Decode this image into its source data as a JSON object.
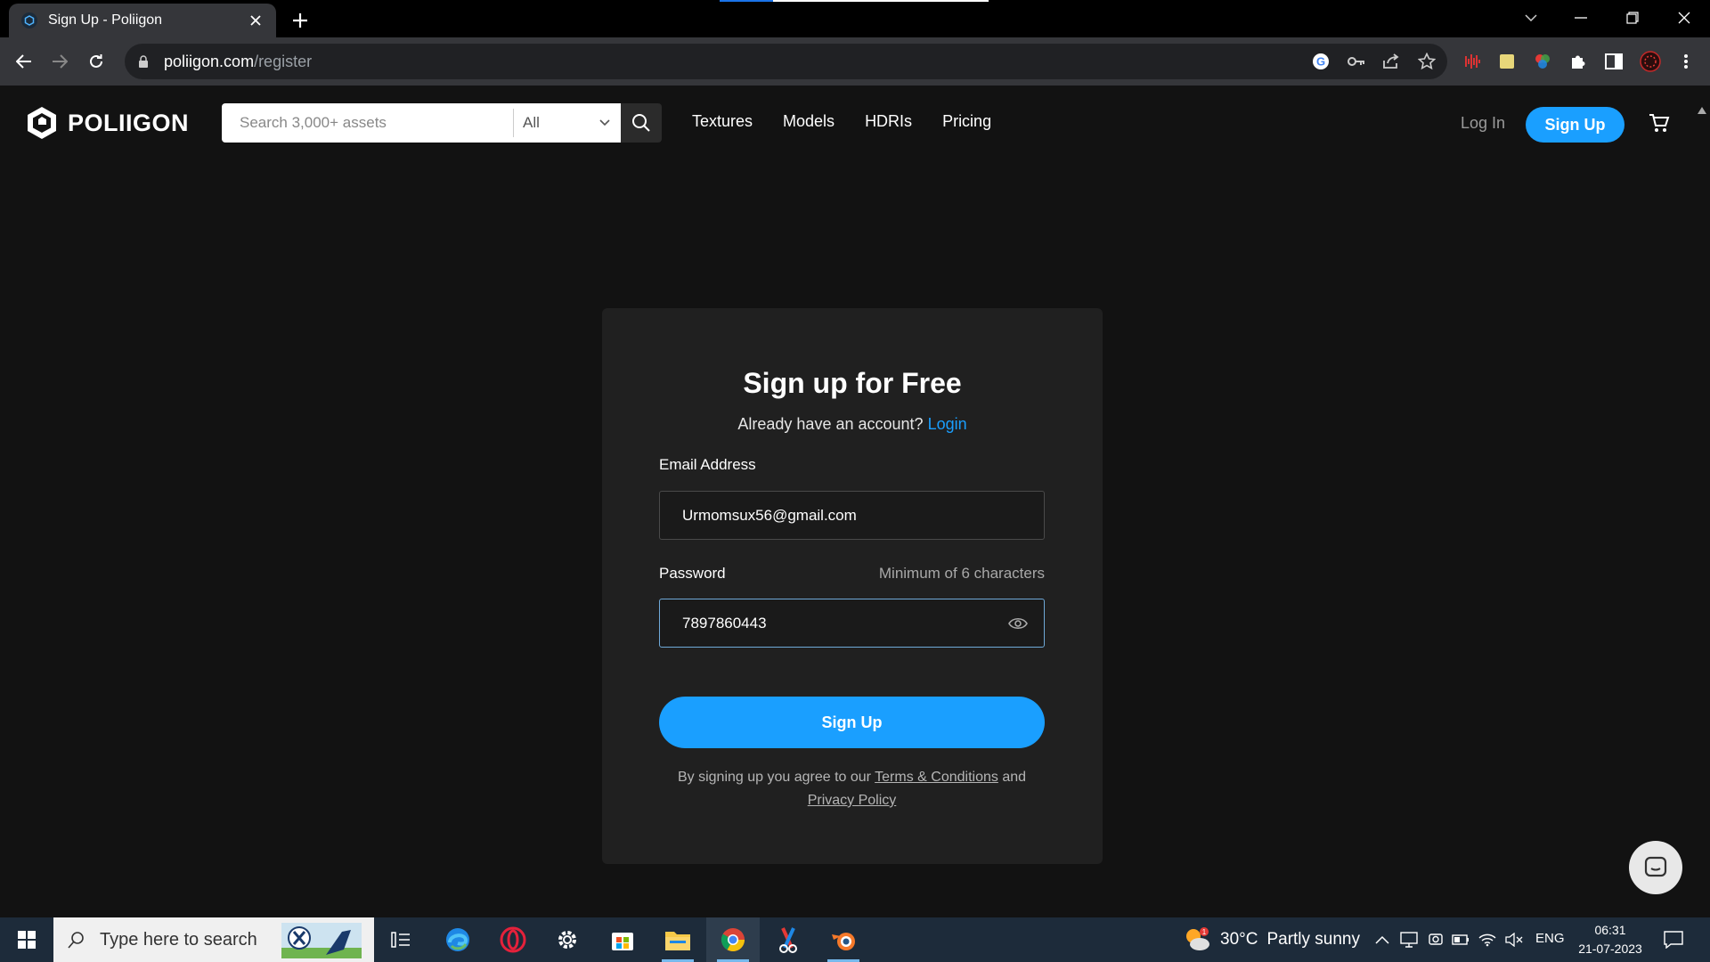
{
  "browser": {
    "tab_title": "Sign Up - Poliigon",
    "url_host": "poliigon.com",
    "url_path": "/register"
  },
  "header": {
    "brand": "POLIIGON",
    "search_placeholder": "Search 3,000+ assets",
    "filter_selected": "All",
    "nav": [
      "Textures",
      "Models",
      "HDRIs",
      "Pricing"
    ],
    "login_label": "Log In",
    "signup_label": "Sign Up"
  },
  "form": {
    "title": "Sign up for Free",
    "already_text": "Already have an account?",
    "login_link": "Login",
    "email_label": "Email Address",
    "email_value": "Urmomsux56@gmail.com",
    "password_label": "Password",
    "password_hint": "Minimum of 6 characters",
    "password_value": "7897860443",
    "submit_label": "Sign Up",
    "terms_prefix": "By signing up you agree to our",
    "terms_link": "Terms & Conditions",
    "terms_and": "and",
    "privacy_link": "Privacy Policy"
  },
  "taskbar": {
    "search_text": "Type here to search",
    "weather_temp": "30°C",
    "weather_desc": "Partly sunny",
    "language": "ENG",
    "time": "06:31",
    "date": "21-07-2023"
  },
  "colors": {
    "accent": "#1a9fff",
    "page_bg": "#121212",
    "card_bg": "#202020"
  }
}
